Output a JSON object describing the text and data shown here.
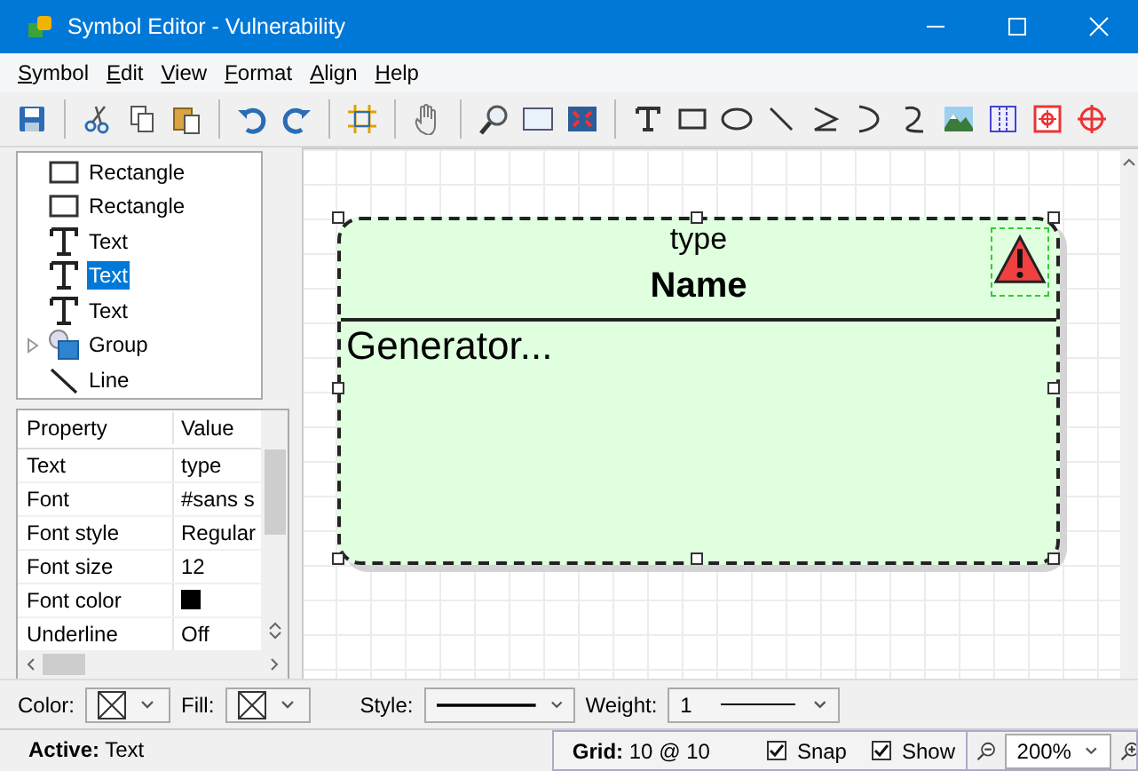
{
  "window": {
    "title": "Symbol Editor - Vulnerability"
  },
  "menu": [
    "Symbol",
    "Edit",
    "View",
    "Format",
    "Align",
    "Help"
  ],
  "tree": [
    {
      "kind": "rect",
      "label": "Rectangle",
      "selected": false
    },
    {
      "kind": "rect",
      "label": "Rectangle",
      "selected": false
    },
    {
      "kind": "text",
      "label": "Text",
      "selected": false
    },
    {
      "kind": "text",
      "label": "Text",
      "selected": true
    },
    {
      "kind": "text",
      "label": "Text",
      "selected": false
    },
    {
      "kind": "group",
      "label": "Group",
      "selected": false,
      "expanded": false
    },
    {
      "kind": "line",
      "label": "Line",
      "selected": false
    }
  ],
  "properties": {
    "columns": [
      "Property",
      "Value"
    ],
    "rows": [
      {
        "name": "Text",
        "kind": "text",
        "value": "type"
      },
      {
        "name": "Font",
        "kind": "text",
        "value": "#sans s"
      },
      {
        "name": "Font style",
        "kind": "text",
        "value": "Regular"
      },
      {
        "name": "Font size",
        "kind": "text",
        "value": "12"
      },
      {
        "name": "Font color",
        "kind": "color",
        "color": "#000000"
      },
      {
        "name": "Underline",
        "kind": "text",
        "value": "Off"
      }
    ]
  },
  "symbol": {
    "type": "type",
    "name": "Name",
    "body": "Generator..."
  },
  "format_bar": {
    "color_label": "Color:",
    "fill_label": "Fill:",
    "style_label": "Style:",
    "weight_label": "Weight:",
    "weight_value": "1"
  },
  "status_bar": {
    "active_label": "Active:",
    "active_value": "Text",
    "grid_label": "Grid:",
    "grid_value": "10 @ 10",
    "snap": {
      "label": "Snap",
      "checked": true
    },
    "show": {
      "label": "Show",
      "checked": true
    },
    "zoom": "200%"
  }
}
